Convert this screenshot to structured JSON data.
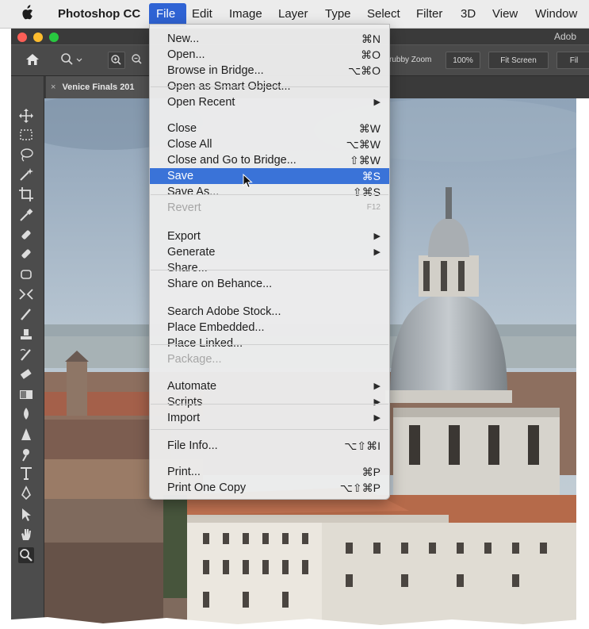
{
  "menubar": {
    "apple_icon": "apple-logo",
    "app_name": "Photoshop CC",
    "items": [
      "File",
      "Edit",
      "Image",
      "Layer",
      "Type",
      "Select",
      "Filter",
      "3D",
      "View",
      "Window"
    ]
  },
  "window": {
    "title_partial": "Adob",
    "traffic_lights": [
      "#fc5f57",
      "#fdbc2e",
      "#28c840"
    ]
  },
  "options_bar": {
    "zoom_value": "100%",
    "scrubby_label": "rubby Zoom",
    "fit_screen": "Fit Screen",
    "fill_partial": "Fil"
  },
  "document_tab": {
    "close": "×",
    "title": "Venice Finals 201"
  },
  "tools": [
    "move",
    "marquee",
    "lasso",
    "magic-wand",
    "crop",
    "eyedropper",
    "healing",
    "brush-bandage",
    "patch",
    "content-aware-move",
    "brush",
    "clone-stamp",
    "history-brush",
    "eraser",
    "gradient",
    "blur",
    "sharpen",
    "dodge",
    "type",
    "pen",
    "path-selection",
    "hand",
    "zoom"
  ],
  "file_menu": {
    "items": [
      {
        "label": "New...",
        "shortcut": "⌘N"
      },
      {
        "label": "Open...",
        "shortcut": "⌘O"
      },
      {
        "label": "Browse in Bridge...",
        "shortcut": "⌥⌘O"
      },
      {
        "label": "Open as Smart Object..."
      },
      {
        "label": "Open Recent",
        "submenu": true
      },
      {
        "label": "Close",
        "shortcut": "⌘W"
      },
      {
        "label": "Close All",
        "shortcut": "⌥⌘W"
      },
      {
        "label": "Close and Go to Bridge...",
        "shortcut": "⇧⌘W"
      },
      {
        "label": "Save",
        "shortcut": "⌘S",
        "highlighted": true
      },
      {
        "label": "Save As...",
        "shortcut": "⇧⌘S"
      },
      {
        "label": "Revert",
        "shortcut": "F12",
        "disabled": true
      },
      {
        "label": "Export",
        "submenu": true
      },
      {
        "label": "Generate",
        "submenu": true
      },
      {
        "label": "Share..."
      },
      {
        "label": "Share on Behance..."
      },
      {
        "label": "Search Adobe Stock..."
      },
      {
        "label": "Place Embedded..."
      },
      {
        "label": "Place Linked..."
      },
      {
        "label": "Package...",
        "disabled": true
      },
      {
        "label": "Automate",
        "submenu": true
      },
      {
        "label": "Scripts",
        "submenu": true
      },
      {
        "label": "Import",
        "submenu": true
      },
      {
        "label": "File Info...",
        "shortcut": "⌥⇧⌘I"
      },
      {
        "label": "Print...",
        "shortcut": "⌘P"
      },
      {
        "label": "Print One Copy",
        "shortcut": "⌥⇧⌘P"
      }
    ],
    "submenu_arrow": "▶"
  },
  "colors": {
    "menu_highlight": "#3a73d8",
    "menubar_highlight": "#2f63d4",
    "ps_panel": "#4a4a4a"
  }
}
